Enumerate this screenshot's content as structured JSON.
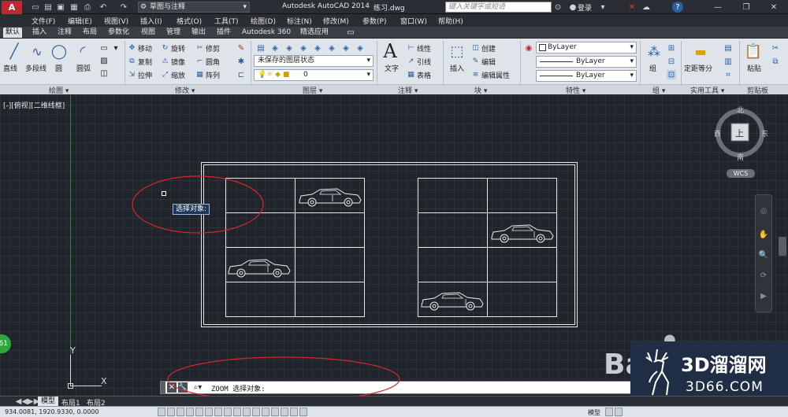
{
  "app": {
    "title": "Autodesk AutoCAD 2014",
    "filename": "练习.dwg",
    "workspace": "草图与注释",
    "search_placeholder": "键入关键字或短语",
    "login": "登录",
    "window_buttons": [
      "—",
      "❐",
      "✕"
    ]
  },
  "menu": {
    "items": [
      "文件(F)",
      "编辑(E)",
      "视图(V)",
      "插入(I)",
      "格式(O)",
      "工具(T)",
      "绘图(D)",
      "标注(N)",
      "修改(M)",
      "参数(P)",
      "窗口(W)",
      "帮助(H)"
    ]
  },
  "ribbon_tabs": [
    "默认",
    "插入",
    "注释",
    "布局",
    "参数化",
    "视图",
    "管理",
    "输出",
    "插件",
    "Autodesk 360",
    "精选应用"
  ],
  "panels": {
    "draw": {
      "label": "绘图 ▾",
      "tools": [
        "直线",
        "多段线",
        "圆",
        "圆弧"
      ]
    },
    "modify": {
      "label": "修改 ▾",
      "tools": [
        "移动",
        "旋转",
        "修剪",
        "复制",
        "镜像",
        "圆角",
        "拉伸",
        "缩放",
        "阵列"
      ]
    },
    "layers": {
      "label": "图层 ▾",
      "layer_state": "未保存的图层状态",
      "current_layer": "0"
    },
    "annotation": {
      "label": "注释 ▾",
      "text_label": "文字",
      "tools": [
        "线性",
        "引线",
        "表格"
      ]
    },
    "block": {
      "label": "块 ▾",
      "insert_label": "插入",
      "tools": [
        "创建",
        "编辑",
        "编辑属性"
      ]
    },
    "properties": {
      "label": "特性 ▾",
      "color": "ByLayer",
      "linetype": "ByLayer",
      "lineweight": "ByLayer"
    },
    "groups": {
      "label": "组 ▾",
      "tool": "组"
    },
    "utilities": {
      "label": "实用工具 ▾",
      "tool": "定距等分"
    },
    "clipboard": {
      "label": "剪贴板",
      "tool": "粘贴"
    }
  },
  "viewport": {
    "label": "[-][俯视][二维线框]",
    "tooltip": "选择对象:",
    "viewcube": {
      "north": "北",
      "south": "南",
      "east": "东",
      "west": "西",
      "top": "上",
      "wcs": "WCS"
    },
    "ucs": {
      "y": "Y",
      "x": "X"
    },
    "badge": "61"
  },
  "command": {
    "prompt": "ZOOM 选择对象:"
  },
  "layout_tabs": [
    "模型",
    "布局1",
    "布局2"
  ],
  "status": {
    "coordinates": "934.0081, 1920.9330, 0.0000",
    "model_label": "模型"
  },
  "watermark": {
    "text": "3D溜溜网",
    "url": "3D66.COM",
    "partial": "Ba"
  },
  "colors": {
    "accent_red": "#c0282f",
    "viewport_bg": "#20242b",
    "ribbon_bg": "#dfe4ea",
    "annotation_ellipse": "#d8262c",
    "watermark_bg": "#1f2d45"
  }
}
